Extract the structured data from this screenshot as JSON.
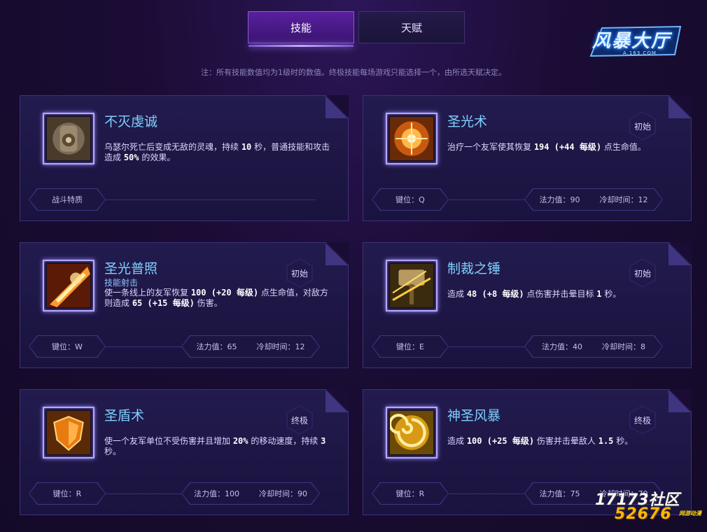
{
  "tabs": [
    {
      "label": "技能",
      "active": true
    },
    {
      "label": "天赋",
      "active": false
    }
  ],
  "note": "注：所有技能数值均为1级时的数值。终极技能每场游戏只能选择一个，由所选天赋决定。",
  "logo": {
    "text": "风暴大厅",
    "sub": "A.163.COM"
  },
  "cards": [
    {
      "title": "不灭虔诚",
      "subtitle": "",
      "badge": "",
      "desc_parts": [
        "乌瑟尔死亡后变成无敌的灵魂，持续 ",
        "10",
        " 秒，普通技能和攻击造成 ",
        "50%",
        " 的效果。"
      ],
      "key": "战斗特质",
      "mana": "",
      "cooldown": "",
      "icon": "chained-gauntlet-icon"
    },
    {
      "title": "圣光术",
      "subtitle": "",
      "badge": "初始",
      "desc_parts": [
        "治疗一个友军使其恢复 ",
        "194 (+44 每级)",
        " 点生命值。"
      ],
      "key": "键位：Q",
      "mana": "法力值：90",
      "cooldown": "冷却时间：12",
      "icon": "holy-light-icon"
    },
    {
      "title": "圣光普照",
      "subtitle": "技能射击",
      "badge": "初始",
      "desc_parts": [
        "使一条线上的友军恢复 ",
        "100 (+20 每级)",
        " 点生命值，对敌方则造成 ",
        "65 (+15 每级)",
        " 伤害。"
      ],
      "key": "键位：W",
      "mana": "法力值：65",
      "cooldown": "冷却时间：12",
      "icon": "holy-radiance-icon"
    },
    {
      "title": "制裁之锤",
      "subtitle": "",
      "badge": "初始",
      "desc_parts": [
        "造成 ",
        "48 (+8 每级)",
        " 点伤害并击晕目标 ",
        "1",
        " 秒。"
      ],
      "key": "键位：E",
      "mana": "法力值：40",
      "cooldown": "冷却时间：8",
      "icon": "hammer-of-justice-icon"
    },
    {
      "title": "圣盾术",
      "subtitle": "",
      "badge": "终极",
      "desc_parts": [
        "使一个友军单位不受伤害并且增加 ",
        "20%",
        " 的移动速度，持续 ",
        "3",
        " 秒。"
      ],
      "key": "键位：R",
      "mana": "法力值：100",
      "cooldown": "冷却时间：90",
      "icon": "divine-shield-icon"
    },
    {
      "title": "神圣风暴",
      "subtitle": "",
      "badge": "终极",
      "desc_parts": [
        "造成 ",
        "100 (+25 每级)",
        " 伤害并击晕敌人 ",
        "1.5",
        " 秒。"
      ],
      "key": "键位：R",
      "mana": "法力值：75",
      "cooldown": "冷却时间：70",
      "icon": "divine-storm-icon"
    }
  ],
  "watermark": {
    "line1": "17173社区",
    "line2": "52676",
    "line3": "网游动漫"
  }
}
